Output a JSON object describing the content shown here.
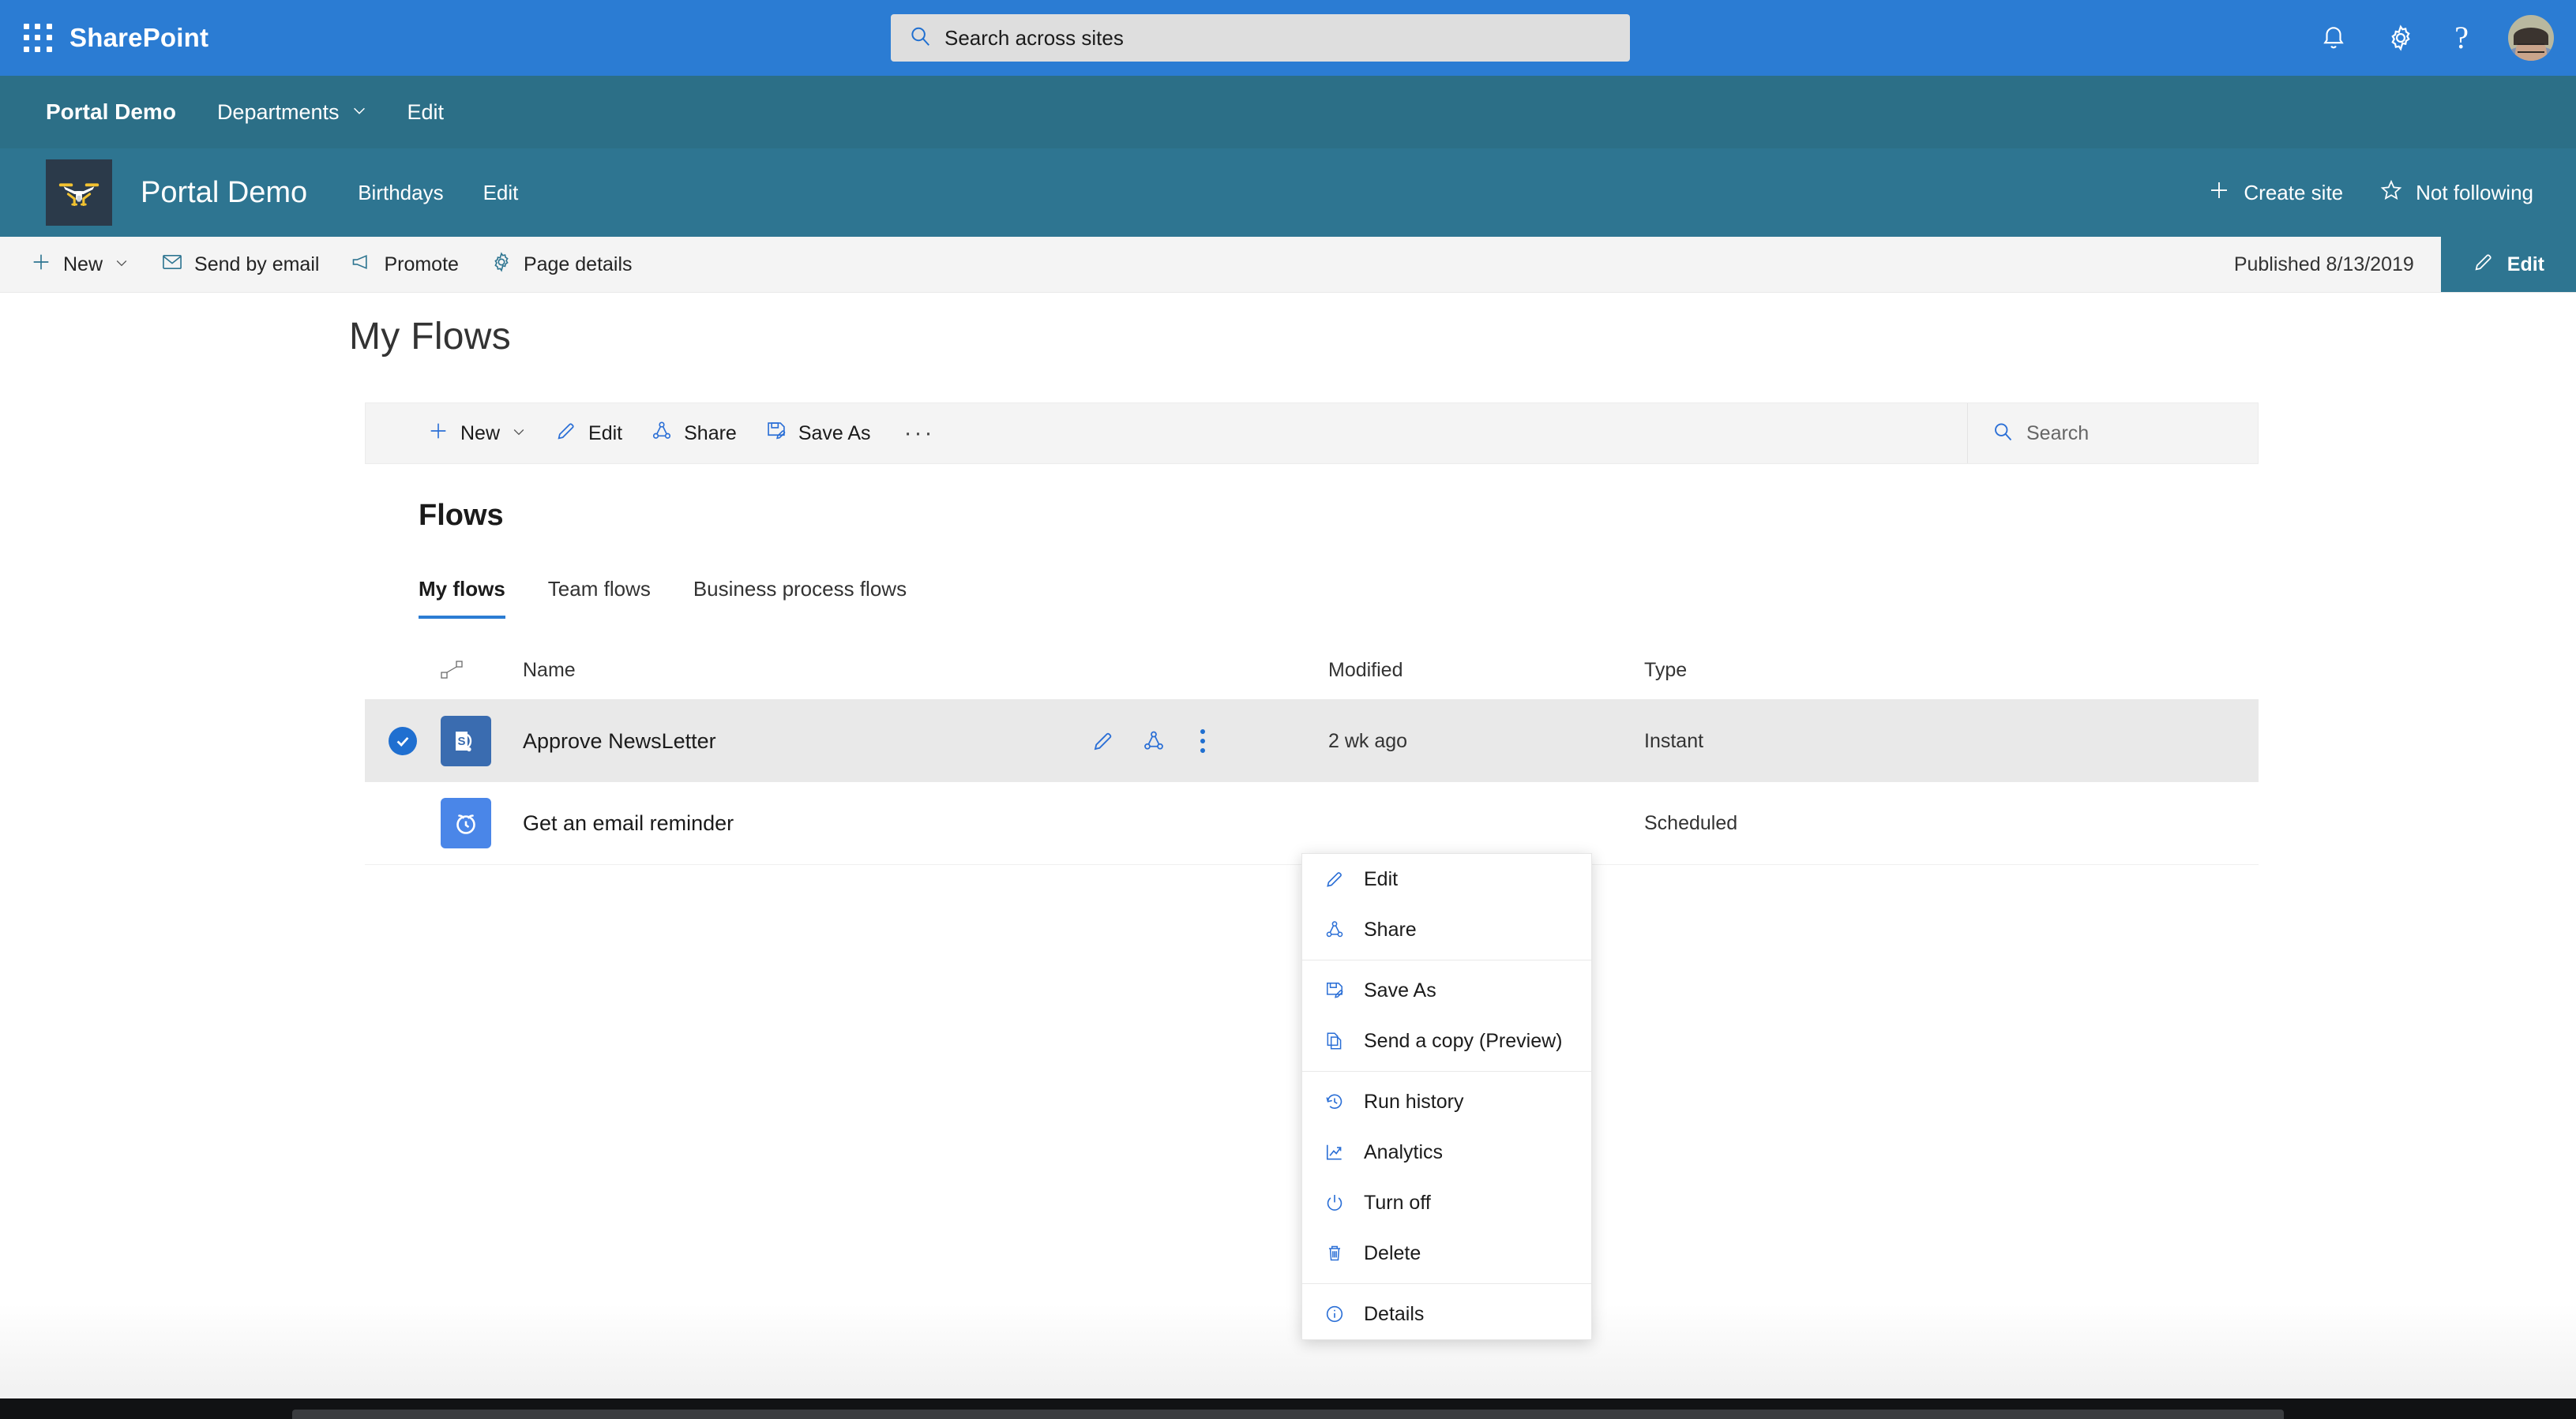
{
  "suite": {
    "waffle_icon": "waffle-grid-icon",
    "brand": "SharePoint",
    "search_placeholder": "Search across sites",
    "search_icon": "search-icon",
    "icons": [
      {
        "name": "notifications-bell-icon",
        "label": "Notifications"
      },
      {
        "name": "settings-gear-icon",
        "label": "Settings"
      },
      {
        "name": "help-question-icon",
        "label": "Help"
      }
    ],
    "avatar_name": "user-avatar"
  },
  "hubnav": {
    "title": "Portal Demo",
    "links": [
      {
        "label": "Departments",
        "has_chevron": true
      },
      {
        "label": "Edit",
        "has_chevron": false
      }
    ]
  },
  "siteheader": {
    "logo_icon": "drone-logo-icon",
    "title": "Portal Demo",
    "links": [
      "Birthdays",
      "Edit"
    ],
    "actions": [
      {
        "label": "Create site",
        "icon": "plus-icon"
      },
      {
        "label": "Not following",
        "icon": "star-outline-icon"
      }
    ]
  },
  "commandbar": {
    "items": [
      {
        "label": "New",
        "icon": "plus-icon",
        "chevron": true
      },
      {
        "label": "Send by email",
        "icon": "mail-icon",
        "chevron": false
      },
      {
        "label": "Promote",
        "icon": "megaphone-icon",
        "chevron": false
      },
      {
        "label": "Page details",
        "icon": "gear-icon",
        "chevron": false
      }
    ],
    "published": "Published 8/13/2019",
    "edit_label": "Edit",
    "edit_icon": "pencil-icon"
  },
  "page": {
    "title": "My Flows"
  },
  "webpart": {
    "toolbar": [
      {
        "label": "New",
        "icon": "plus-icon",
        "chevron": true
      },
      {
        "label": "Edit",
        "icon": "pencil-icon",
        "chevron": false
      },
      {
        "label": "Share",
        "icon": "share-icon",
        "chevron": false
      },
      {
        "label": "Save As",
        "icon": "save-as-icon",
        "chevron": false
      }
    ],
    "overflow_label": "···",
    "search_placeholder": "Search",
    "search_icon": "search-icon",
    "heading": "Flows",
    "tabs": [
      {
        "label": "My flows",
        "active": true
      },
      {
        "label": "Team flows",
        "active": false
      },
      {
        "label": "Business process flows",
        "active": false
      }
    ],
    "table": {
      "columns": {
        "flowicon": "",
        "name": "Name",
        "modified": "Modified",
        "type": "Type"
      },
      "header_icon": "flow-connector-icon",
      "rows": [
        {
          "selected": true,
          "icon": "sharepoint-tile-icon",
          "name": "Approve NewsLetter",
          "actions": [
            {
              "icon": "pencil-icon",
              "name": "edit-flow-icon"
            },
            {
              "icon": "share-icon",
              "name": "share-flow-icon"
            },
            {
              "icon": "kebab-icon",
              "name": "more-commands-icon"
            }
          ],
          "modified": "2 wk ago",
          "type": "Instant"
        },
        {
          "selected": false,
          "icon": "alarm-clock-tile-icon",
          "name": "Get an email reminder",
          "actions": [],
          "modified": "",
          "type": "Scheduled"
        }
      ]
    }
  },
  "context_menu": {
    "groups": [
      [
        {
          "label": "Edit",
          "icon": "pencil-icon"
        },
        {
          "label": "Share",
          "icon": "share-icon"
        }
      ],
      [
        {
          "label": "Save As",
          "icon": "save-as-icon"
        },
        {
          "label": "Send a copy (Preview)",
          "icon": "copy-icon"
        }
      ],
      [
        {
          "label": "Run history",
          "icon": "history-icon"
        },
        {
          "label": "Analytics",
          "icon": "analytics-chart-icon"
        },
        {
          "label": "Turn off",
          "icon": "power-icon"
        },
        {
          "label": "Delete",
          "icon": "trash-icon"
        }
      ],
      [
        {
          "label": "Details",
          "icon": "info-circle-icon"
        }
      ]
    ]
  },
  "colors": {
    "suitebar": "#2b7cd3",
    "hubnav": "#2c6f87",
    "siteheader": "#2e7591",
    "accent_blue": "#1f6fd0",
    "selected_row": "#e9e9e9"
  }
}
